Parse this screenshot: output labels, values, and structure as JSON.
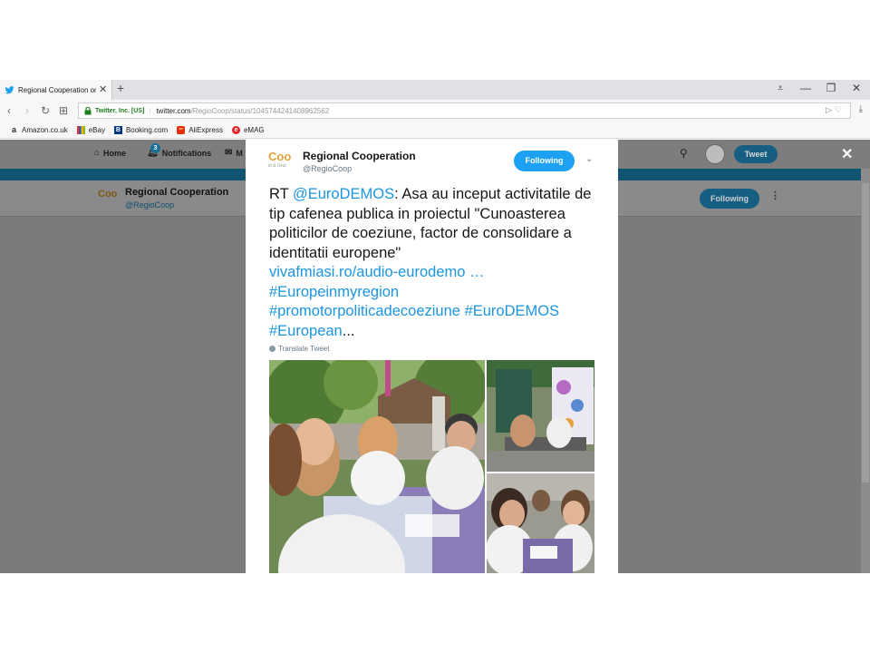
{
  "browser": {
    "tab_title": "Regional Cooperation on",
    "new_tab": "+",
    "ev_label": "Twitter, Inc. [US]",
    "url_host": "twitter.com",
    "url_path": "/RegioCoop/status/1045744241408962562",
    "bookmarks": [
      {
        "label": "Amazon.co.uk",
        "icon": "amazon-icon",
        "color": "#232f3e"
      },
      {
        "label": "eBay",
        "icon": "ebay-icon",
        "color": "#e53238"
      },
      {
        "label": "Booking.com",
        "icon": "booking-icon",
        "color": "#003580"
      },
      {
        "label": "AliExpress",
        "icon": "aliexpress-icon",
        "color": "#e62e04"
      },
      {
        "label": "eMAG",
        "icon": "emag-icon",
        "color": "#e42127"
      }
    ]
  },
  "twitter_nav": {
    "home": "Home",
    "notifications": "Notifications",
    "notif_count": "3",
    "messages": "M",
    "tweet_button": "Tweet"
  },
  "profile": {
    "logo_text": "Coo",
    "name": "Regional Cooperation",
    "handle": "@RegioCoop",
    "follow_label": "Following"
  },
  "modal": {
    "logo_text": "Coo",
    "logo_sub": "ld & Grur",
    "name": "Regional Cooperation",
    "handle": "@RegioCoop",
    "follow_label": "Following",
    "text_rt": "RT ",
    "mention": "@EuroDEMOS",
    "text_body": ": Asa au inceput activitatile de tip cafenea publica in proiectul \"Cunoasterea politicilor de coeziune, factor de consolidare a identitatii europene\"",
    "link": "vivafmiasi.ro/audio-eurodemo …",
    "hashtag1": "#Europeinmyregion",
    "hashtag2": "#promotorpoliticadecoeziune",
    "hashtag3": "#EuroDEMOS",
    "hashtag4": "#European",
    "ellipsis": "...",
    "translate": "Translate Tweet"
  },
  "colors": {
    "twitter_blue": "#1da1f2",
    "link_blue": "#1b95e0",
    "overlay_gray": "#7b7b7b"
  }
}
